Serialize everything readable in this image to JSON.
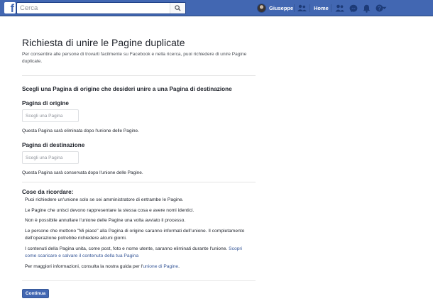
{
  "topbar": {
    "logo": "f",
    "search_placeholder": "Cerca",
    "user_name": "Giuseppe",
    "home_label": "Home",
    "icons": [
      "search-icon",
      "find-friends-icon",
      "friend-requests-icon",
      "messages-icon",
      "notifications-icon",
      "help-icon",
      "dropdown-arrow-icon"
    ],
    "brand_color": "#4267b2"
  },
  "header": {
    "title": "Richiesta di unire le Pagine duplicate",
    "description": "Per consentire alle persone di trovarti facilmente su Facebook e nella ricerca, puoi richiedere di unire Pagine duplicate."
  },
  "merge": {
    "section_title": "Scegli una Pagina di origine che desideri unire a una Pagina di destinazione",
    "source": {
      "label": "Pagina di origine",
      "placeholder": "Scegli una Pagina",
      "note": "Questa Pagina sarà eliminata dopo l'unione delle Pagine."
    },
    "destination": {
      "label": "Pagina di destinazione",
      "placeholder": "Scegli una Pagina",
      "note": "Questa Pagina sarà conservata dopo l'unione delle Pagine."
    }
  },
  "remember": {
    "title": "Cose da ricordare:",
    "items": [
      "Puoi richiedere un'unione solo se sei amministratore di entrambe le Pagine.",
      "Le Pagine che unisci devono rappresentare la stessa cosa e avere nomi identici.",
      "Non è possibile annullare l'unione delle Pagine una volta avviato il processo.",
      "Le persone che mettono \"Mi piace\" alla Pagina di origine saranno informati dell'unione. Il completamento dell'operazione potrebbe richiedere alcuni giorni."
    ],
    "content_text": "I contenuti della Pagina unita, come post, foto e nome utente, saranno eliminati durante l'unione.",
    "content_link": "Scopri come scaricare e salvare il contenuto della tua Pagina",
    "info_text": "Per maggiori informazioni, consulta la nostra guida per l'",
    "info_link": "unione di Pagine",
    "info_end": "."
  },
  "actions": {
    "continue_label": "Continua"
  }
}
